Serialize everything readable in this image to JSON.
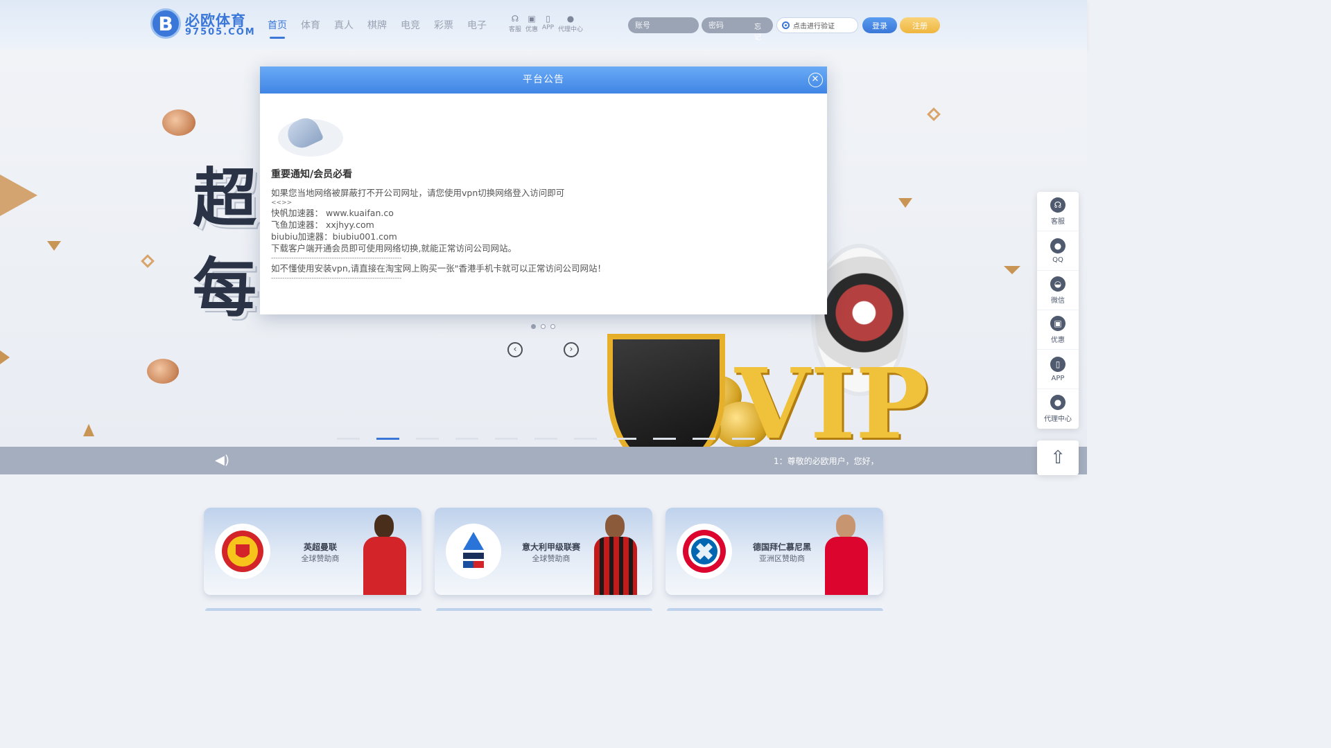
{
  "header": {
    "logo_icon": "B",
    "logo_name": "必欧体育",
    "logo_domain": "97505.COM",
    "nav": [
      {
        "label": "首页",
        "active": true
      },
      {
        "label": "体育"
      },
      {
        "label": "真人"
      },
      {
        "label": "棋牌"
      },
      {
        "label": "电竞"
      },
      {
        "label": "彩票"
      },
      {
        "label": "电子"
      }
    ],
    "tools": [
      {
        "label": "客服",
        "icon": "headset-icon"
      },
      {
        "label": "优惠",
        "icon": "gift-icon"
      },
      {
        "label": "APP",
        "icon": "app-icon"
      },
      {
        "label": "代理中心",
        "icon": "users-icon"
      }
    ],
    "login": {
      "account_placeholder": "账号",
      "password_placeholder": "密码",
      "forgot": "忘记",
      "verify": "点击进行验证",
      "login_button": "登录",
      "register_button": "注册"
    }
  },
  "banner": {
    "headline_1": "超",
    "headline_2": "每",
    "vip_text": "VIP",
    "slide_dots": 3,
    "prev_icon": "chevron-left-icon",
    "next_icon": "chevron-right-icon",
    "pager_count": 11,
    "pager_active": 1
  },
  "marquee": {
    "icon": "speaker-icon",
    "text": "1：尊敬的必欧用户，您好，"
  },
  "sponsors": [
    {
      "title": "英超曼联",
      "subtitle": "全球赞助商",
      "logo": "manchester-united-logo",
      "accent": "#d3242a"
    },
    {
      "title": "意大利甲级联赛",
      "subtitle": "全球赞助商",
      "logo": "serie-a-logo",
      "accent": "#1a4fa0"
    },
    {
      "title": "德国拜仁慕尼黑",
      "subtitle": "亚洲区赞助商",
      "logo": "bayern-munich-logo",
      "accent": "#dc052d"
    }
  ],
  "float_bar": [
    {
      "label": "客服",
      "icon": "headset-icon"
    },
    {
      "label": "QQ",
      "icon": "qq-icon"
    },
    {
      "label": "微信",
      "icon": "wechat-icon"
    },
    {
      "label": "优惠",
      "icon": "gift-icon"
    },
    {
      "label": "APP",
      "icon": "app-icon"
    },
    {
      "label": "代理中心",
      "icon": "users-icon"
    }
  ],
  "back_top_icon": "arrow-up-icon",
  "modal": {
    "title": "平台公告",
    "close_icon": "close-icon",
    "notice_title": "重要通知/会员必看",
    "lines": [
      "如果您当地网络被屏蔽打不开公司网址，请您使用vpn切换网络登入访问即可",
      "<<>>",
      "快帆加速器： www.kuaifan.co",
      "飞鱼加速器： xxjhyy.com",
      "biubiu加速器：biubiu001.com",
      "下载客户端开通会员即可使用网络切换,就能正常访问公司网站。",
      "----------------------------------------------------------",
      "如不懂使用安装vpn,请直接在淘宝网上购买一张\"香港手机卡就可以正常访问公司网站！",
      "----------------------------------------------------------"
    ]
  },
  "colors": {
    "primary": "#3a77d8",
    "gold": "#efb63e",
    "marquee_bg": "#a5aebe"
  }
}
